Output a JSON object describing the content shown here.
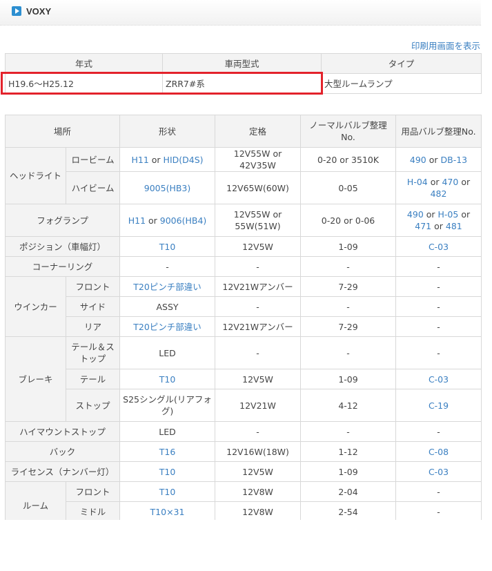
{
  "header": {
    "title": "VOXY"
  },
  "print_link": "印刷用画面を表示",
  "vehicle_table": {
    "columns": [
      "年式",
      "車両型式",
      "タイプ"
    ],
    "row": [
      "H19.6〜H25.12",
      "ZRR7#系",
      "大型ルームランプ"
    ]
  },
  "bulb_table": {
    "columns": [
      "場所",
      "形状",
      "定格",
      "ノーマルバルブ整理No.",
      "用品バルブ整理No."
    ],
    "rows": [
      {
        "cat": "ヘッドライト",
        "sub": "ロービーム",
        "shape": [
          [
            "H11",
            1
          ],
          [
            " or ",
            0
          ],
          [
            "HID(D4S)",
            1
          ]
        ],
        "rating": "12V55W or 42V35W",
        "normal": "0-20 or 3510K",
        "option": [
          [
            "490",
            1
          ],
          [
            " or ",
            0
          ],
          [
            "DB-13",
            1
          ]
        ]
      },
      {
        "cat": "",
        "sub": "ハイビーム",
        "shape": [
          [
            "9005(HB3)",
            1
          ]
        ],
        "rating": "12V65W(60W)",
        "normal": "0-05",
        "option": [
          [
            "H-04",
            1
          ],
          [
            " or ",
            0
          ],
          [
            "470",
            1
          ],
          [
            " or ",
            0
          ],
          [
            "482",
            1
          ]
        ]
      },
      {
        "cat": "フォグランプ",
        "sub": "",
        "shape": [
          [
            "H11",
            1
          ],
          [
            " or ",
            0
          ],
          [
            "9006(HB4)",
            1
          ]
        ],
        "rating": "12V55W or 55W(51W)",
        "normal": "0-20 or 0-06",
        "option": [
          [
            "490",
            1
          ],
          [
            " or ",
            0
          ],
          [
            "H-05",
            1
          ],
          [
            " or ",
            0
          ],
          [
            "471",
            1
          ],
          [
            " or ",
            0
          ],
          [
            "481",
            1
          ]
        ]
      },
      {
        "cat": "ポジション（車幅灯）",
        "sub": "",
        "shape": [
          [
            "T10",
            1
          ]
        ],
        "rating": "12V5W",
        "normal": "1-09",
        "option": [
          [
            "C-03",
            1
          ]
        ]
      },
      {
        "cat": "コーナーリング",
        "sub": "",
        "shape": [
          [
            "-",
            0
          ]
        ],
        "rating": "-",
        "normal": "-",
        "option": [
          [
            "-",
            0
          ]
        ]
      },
      {
        "cat": "ウインカー",
        "sub": "フロント",
        "shape": [
          [
            "T20ピンチ部違い",
            1
          ]
        ],
        "rating": "12V21Wアンバー",
        "normal": "7-29",
        "option": [
          [
            "-",
            0
          ]
        ]
      },
      {
        "cat": "",
        "sub": "サイド",
        "shape": [
          [
            "ASSY",
            0
          ]
        ],
        "rating": "-",
        "normal": "-",
        "option": [
          [
            "-",
            0
          ]
        ]
      },
      {
        "cat": "",
        "sub": "リア",
        "shape": [
          [
            "T20ピンチ部違い",
            1
          ]
        ],
        "rating": "12V21Wアンバー",
        "normal": "7-29",
        "option": [
          [
            "-",
            0
          ]
        ]
      },
      {
        "cat": "ブレーキ",
        "sub": "テール＆ストップ",
        "shape": [
          [
            "LED",
            0
          ]
        ],
        "rating": "-",
        "normal": "-",
        "option": [
          [
            "-",
            0
          ]
        ]
      },
      {
        "cat": "",
        "sub": "テール",
        "shape": [
          [
            "T10",
            1
          ]
        ],
        "rating": "12V5W",
        "normal": "1-09",
        "option": [
          [
            "C-03",
            1
          ]
        ]
      },
      {
        "cat": "",
        "sub": "ストップ",
        "shape": [
          [
            "S25シングル(リアフォグ)",
            0
          ]
        ],
        "rating": "12V21W",
        "normal": "4-12",
        "option": [
          [
            "C-19",
            1
          ]
        ]
      },
      {
        "cat": "ハイマウントストップ",
        "sub": "",
        "shape": [
          [
            "LED",
            0
          ]
        ],
        "rating": "-",
        "normal": "-",
        "option": [
          [
            "-",
            0
          ]
        ]
      },
      {
        "cat": "バック",
        "sub": "",
        "shape": [
          [
            "T16",
            1
          ]
        ],
        "rating": "12V16W(18W)",
        "normal": "1-12",
        "option": [
          [
            "C-08",
            1
          ]
        ]
      },
      {
        "cat": "ライセンス（ナンバー灯）",
        "sub": "",
        "shape": [
          [
            "T10",
            1
          ]
        ],
        "rating": "12V5W",
        "normal": "1-09",
        "option": [
          [
            "C-03",
            1
          ]
        ]
      },
      {
        "cat": "ルーム",
        "sub": "フロント",
        "shape": [
          [
            "T10",
            1
          ]
        ],
        "rating": "12V8W",
        "normal": "2-04",
        "option": [
          [
            "-",
            0
          ]
        ]
      },
      {
        "cat": "",
        "sub": "ミドル",
        "shape": [
          [
            "T10×31",
            1
          ]
        ],
        "rating": "12V8W",
        "normal": "2-54",
        "option": [
          [
            "-",
            0
          ]
        ]
      },
      {
        "cat": "",
        "sub": "",
        "shape": [
          [
            "",
            0
          ]
        ],
        "rating": "",
        "normal": "",
        "option": [
          [
            "",
            0
          ]
        ]
      }
    ]
  }
}
